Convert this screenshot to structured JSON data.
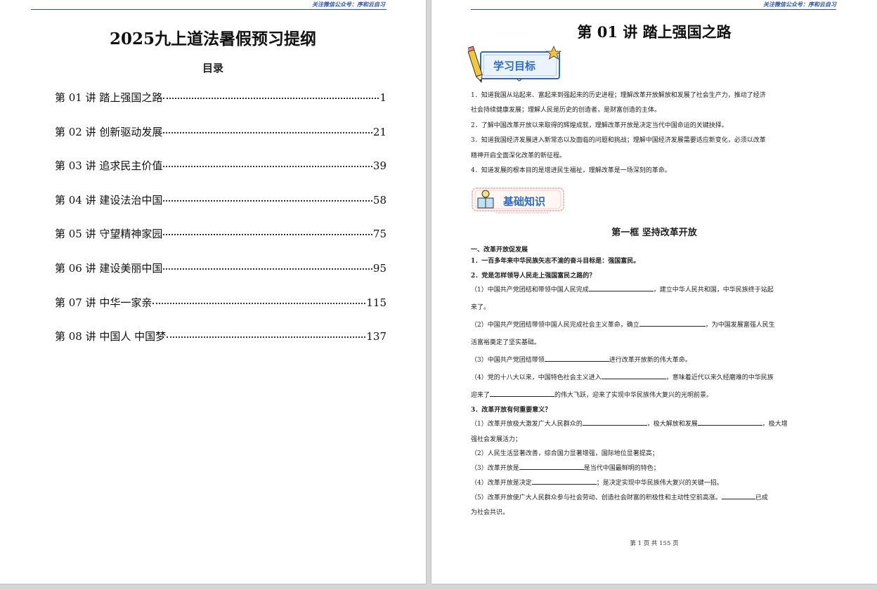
{
  "header_note": "关注微信公众号：序和云自习",
  "left_page": {
    "title": "2025九上道法暑假预习提纲",
    "toc_heading": "目录",
    "toc": [
      {
        "label": "第 01 讲  踏上强国之路",
        "page": "1"
      },
      {
        "label": "第 02 讲  创新驱动发展",
        "page": "21"
      },
      {
        "label": "第 03 讲  追求民主价值",
        "page": "39"
      },
      {
        "label": "第 04 讲  建设法治中国",
        "page": "58"
      },
      {
        "label": "第 05 讲  守望精神家园",
        "page": "75"
      },
      {
        "label": "第 06 讲  建设美丽中国",
        "page": "95"
      },
      {
        "label": "第 07 讲  中华一家亲",
        "page": "115"
      },
      {
        "label": "第 08 讲  中国人  中国梦",
        "page": "137"
      }
    ]
  },
  "right_page": {
    "lecture_title": "第 01 讲  踏上强国之路",
    "badge_goals": "学习目标",
    "badge_basic": "基础知识",
    "goals": [
      "1．知道我国从站起来、富起来到强起来的历史进程；理解改革开放解放和发展了社会生产力，推动了经济",
      "社会持续健康发展；理解人民是历史的创造者，是财富创造的主体。",
      "2．了解中国改革开放以来取得的辉煌成就，理解改革开放是决定当代中国命运的关键抉择。",
      "3．知道我国经济发展进入新常态以及面临的问题和挑战；理解中国经济发展需要适应新变化，必须以改革",
      "精神开启全面深化改革的新征程。",
      "4．知道发展的根本目的是增进民生福祉，理解改革是一场深刻的革命。"
    ],
    "section_title": "第一框  坚持改革开放",
    "heading_1": "一、改革开放促发展",
    "q1": "1．一百多年来中华民族矢志不渝的奋斗目标是：强国富民。",
    "q2": "2．党是怎样领导人民走上强国富民之路的？",
    "q2_items": [
      {
        "before": "（1）中国共产党团结和带领中国人民完成",
        "after": "，建立中华人民共和国，中华民族终于站起"
      },
      {
        "cont": "来了。"
      },
      {
        "before": "（2）中国共产党团结带领中国人民完成社会主义革命，确立",
        "after": "，为中国发展富强人民生"
      },
      {
        "cont": "活富裕奠定了坚实基础。"
      },
      {
        "before": "（3）中国共产党团结带领",
        "after": "进行改革开放新的伟大革命。"
      },
      {
        "before": "（4）党的十八大以来，中国特色社会主义进入",
        "after": "，意味着近代以来久经磨难的中华民族"
      },
      {
        "before": "迎来了",
        "after": "的伟大飞跃，迎来了实现中华民族伟大复兴的光明前景。"
      }
    ],
    "q3": "3．改革开放有何重要意义？",
    "q3_items": [
      {
        "before": "（1）改革开放极大激发广大人民群众的",
        "middle": "，极大解放和发展",
        "after": "，极大增"
      },
      {
        "cont": "强社会发展活力；"
      },
      {
        "text": "（2）人民生活显著改善，综合国力显著增强，国际地位显著提高；"
      },
      {
        "before": "（3）改革开放是",
        "after": "是当代中国最鲜明的特色；"
      },
      {
        "before": "（4）改革开放是决定",
        "after": "；是决定实现中华民族伟大复兴的关键一招。"
      },
      {
        "before": "（5）改革开放使广大人民群众参与社会劳动、创造社会财富的积极性和主动性空前高涨。",
        "after": "已成"
      },
      {
        "cont": "为社会共识。"
      }
    ],
    "footer": "第 1 页 共 155 页"
  },
  "colors": {
    "header_blue": "#2a4fb0",
    "badge_blue": "#2b6ac9",
    "badge_gold": "#f2c23a"
  }
}
